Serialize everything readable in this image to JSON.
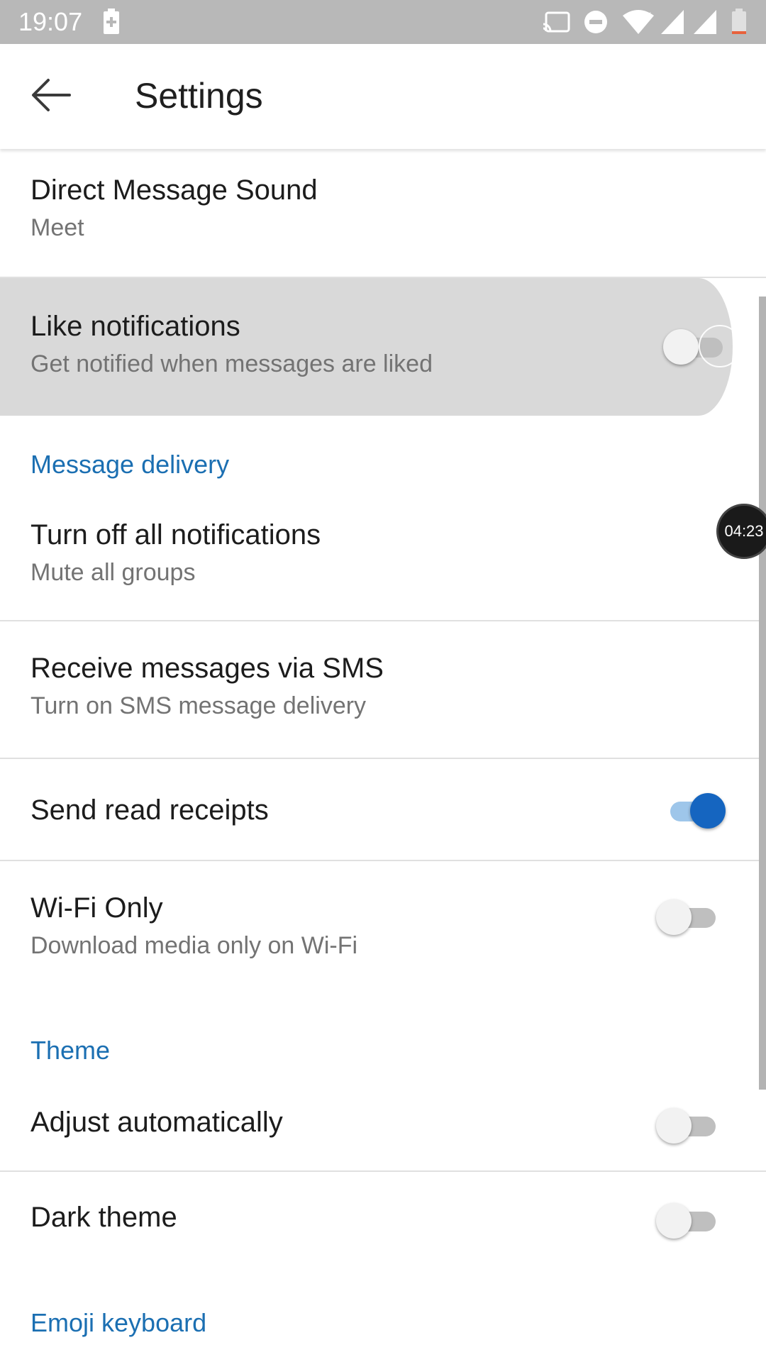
{
  "status_bar": {
    "time": "19:07",
    "icons": [
      "battery-saver-icon",
      "cast-icon",
      "do-not-disturb-icon",
      "wifi-icon",
      "signal-icon",
      "signal-icon",
      "battery-low-icon"
    ]
  },
  "app_bar": {
    "title": "Settings",
    "back_icon": "arrow-back-icon"
  },
  "settings": {
    "direct_message_sound": {
      "title": "Direct Message Sound",
      "subtitle": "Meet"
    },
    "like_notifications": {
      "title": "Like notifications",
      "subtitle": "Get notified when messages are liked",
      "enabled": false
    },
    "section_message_delivery": "Message delivery",
    "turn_off_notifications": {
      "title": "Turn off all notifications",
      "subtitle": "Mute all groups"
    },
    "receive_sms": {
      "title": "Receive messages via SMS",
      "subtitle": "Turn on SMS message delivery"
    },
    "send_read_receipts": {
      "title": "Send read receipts",
      "enabled": true
    },
    "wifi_only": {
      "title": "Wi-Fi Only",
      "subtitle": "Download media only on Wi-Fi",
      "enabled": false
    },
    "section_theme": "Theme",
    "adjust_automatically": {
      "title": "Adjust automatically",
      "enabled": false
    },
    "dark_theme": {
      "title": "Dark theme",
      "enabled": false
    },
    "section_emoji": "Emoji keyboard"
  },
  "overlay_timer": "04:23",
  "colors": {
    "accent": "#1565c0",
    "section": "#1b6fb2",
    "status_bar": "#b8b8b8"
  }
}
